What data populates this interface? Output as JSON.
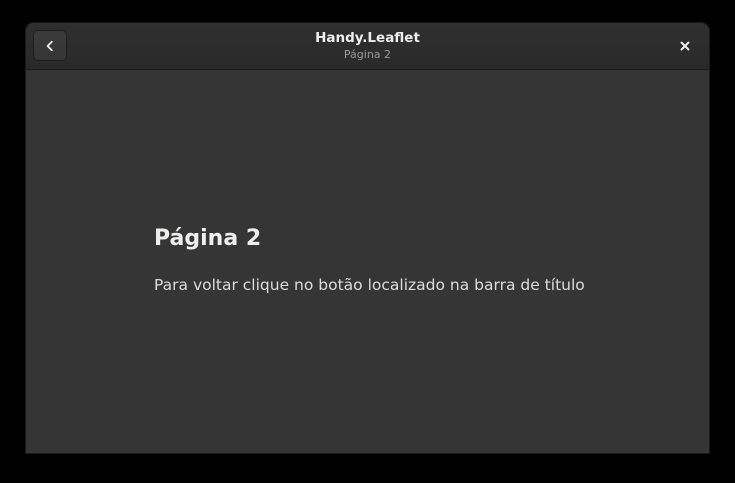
{
  "window": {
    "title": "Handy.Leaflet",
    "subtitle": "Página 2"
  },
  "headerbar": {
    "back_icon": "chevron-left-icon",
    "close_icon": "close-icon"
  },
  "content": {
    "heading": "Página 2",
    "text": "Para voltar clique no botão localizado na barra de título"
  },
  "colors": {
    "background": "#353535",
    "headerbar": "#2c2c2c",
    "text": "#eeeeec"
  }
}
